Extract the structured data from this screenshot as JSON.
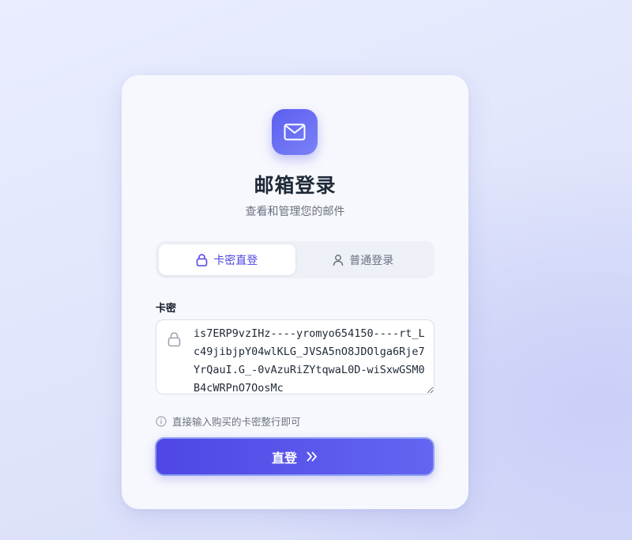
{
  "header": {
    "title": "邮箱登录",
    "subtitle": "查看和管理您的邮件"
  },
  "tabs": [
    {
      "label": "卡密直登",
      "icon": "lock-icon",
      "active": true
    },
    {
      "label": "普通登录",
      "icon": "user-icon",
      "active": false
    }
  ],
  "form": {
    "field_label": "卡密",
    "card_key_value": "is7ERP9vzIHz----yromyo654150----rt_Lc49jibjpY04wlKLG_JVSA5nO8JDOlga6Rje7YrQauI.G_-0vAzuRiZYtqwaL0D-wiSxwGSM0B4cWRPnO7OosMc",
    "hint": "直接输入购买的卡密整行即可",
    "submit_label": "直登",
    "submit_icon": "double-chevron-right-icon"
  },
  "colors": {
    "accent": "#4f46e5",
    "accent_light": "#6366f1",
    "card_bg": "#f7f8fd"
  }
}
